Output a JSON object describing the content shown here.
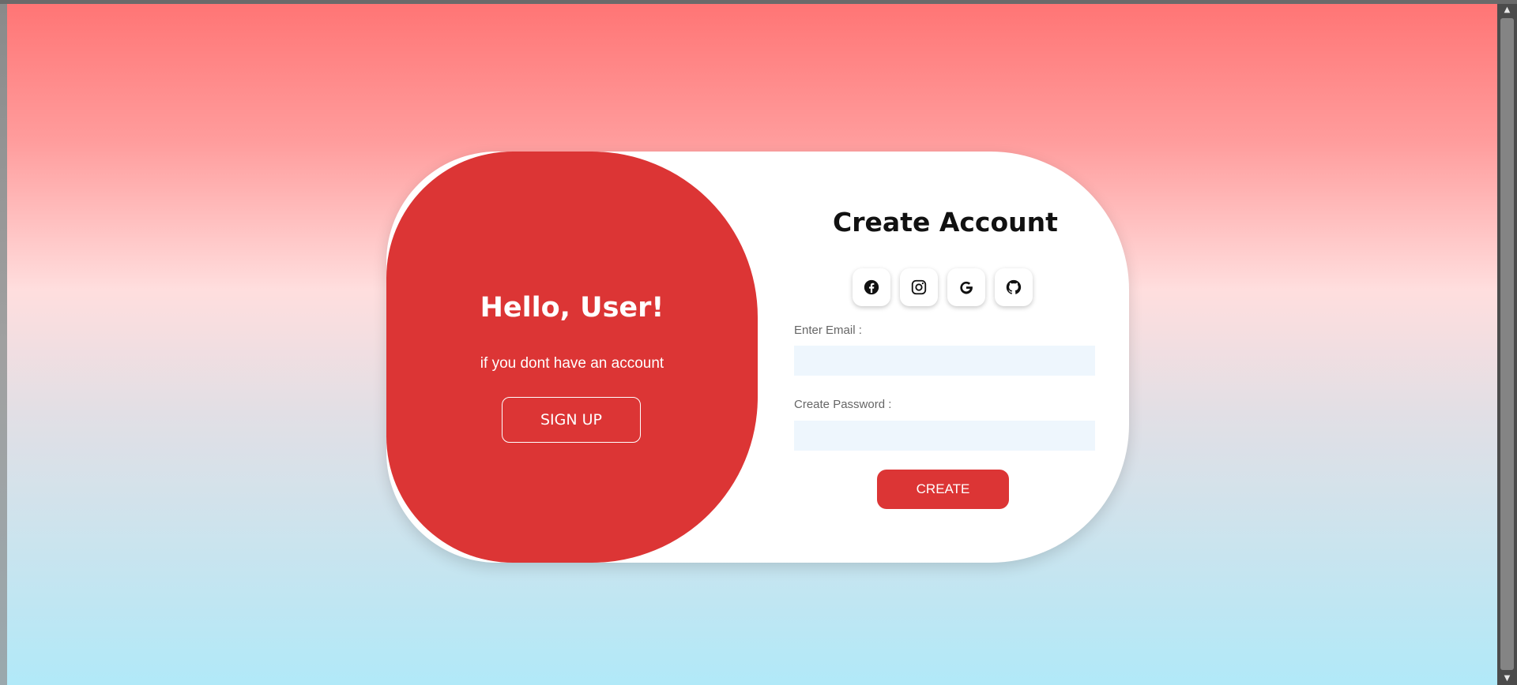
{
  "welcome_panel": {
    "title": "Hello, User!",
    "subtitle": "if you dont have an account",
    "signup_label": "SIGN UP"
  },
  "form": {
    "title": "Create Account",
    "social_icons": [
      "facebook-icon",
      "instagram-icon",
      "google-icon",
      "github-icon"
    ],
    "email_label": "Enter Email :",
    "email_value": "",
    "password_label": "Create Password :",
    "password_value": "",
    "create_label": "CREATE"
  },
  "colors": {
    "accent": "#dc3535",
    "input_bg": "#eef6fd",
    "card_bg": "#ffffff"
  }
}
